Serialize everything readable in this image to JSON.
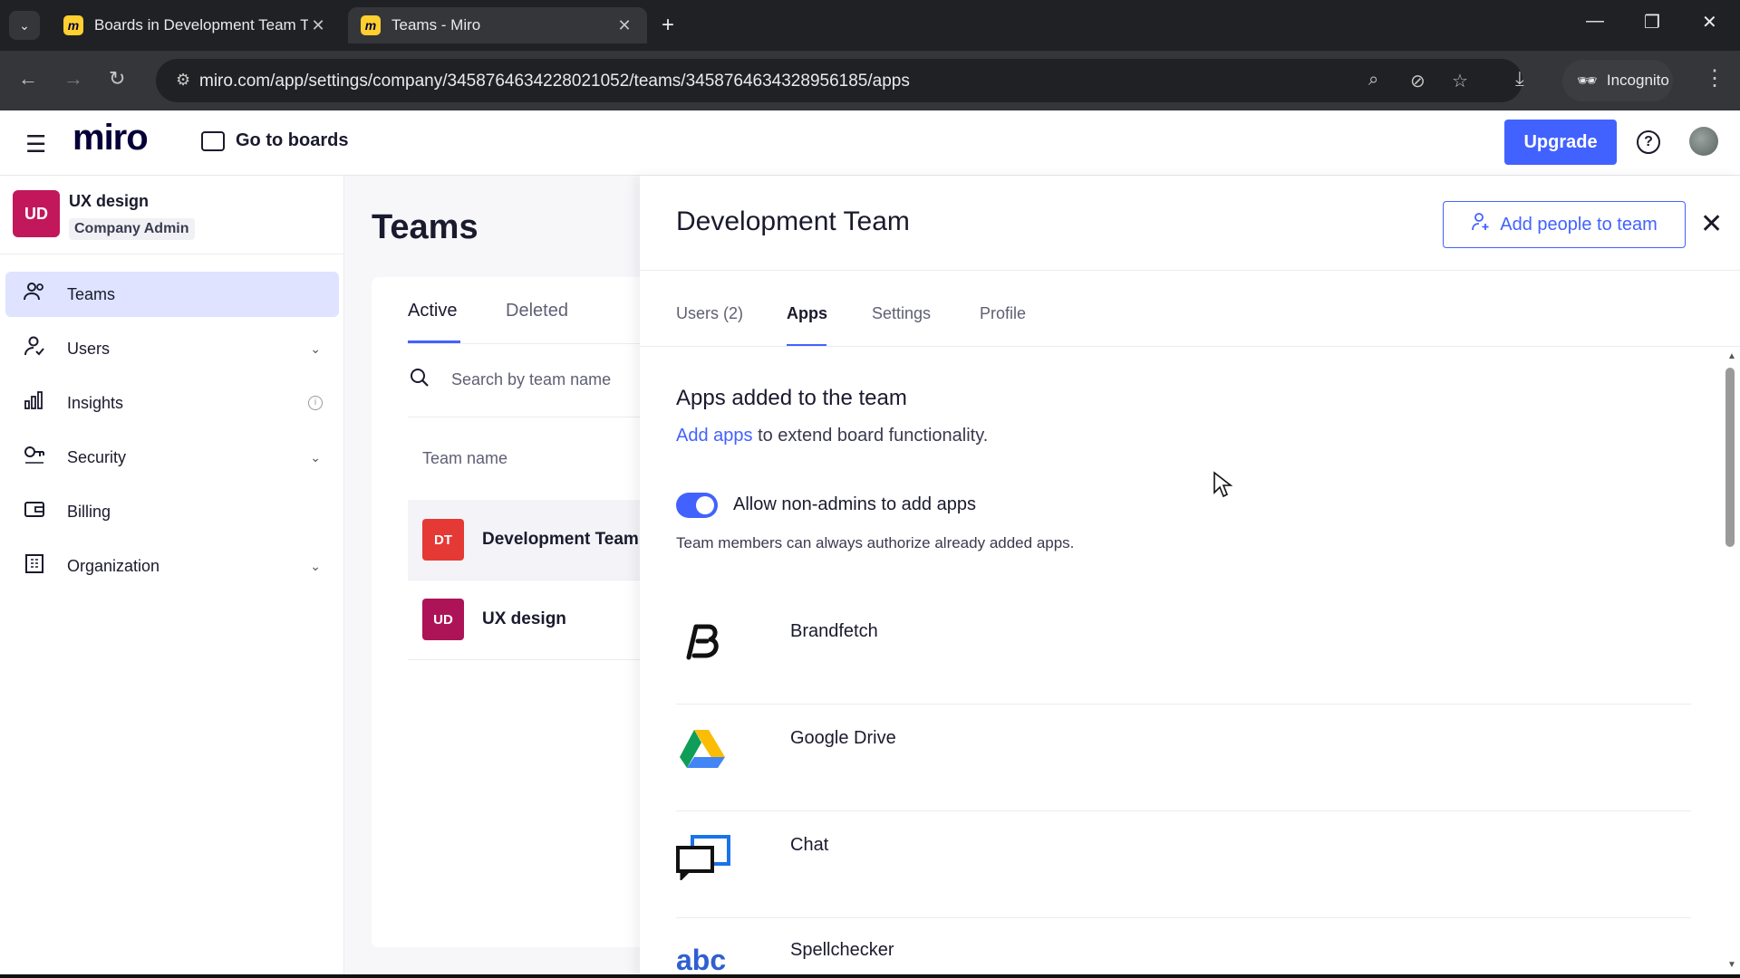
{
  "browser": {
    "tabs": [
      {
        "favicon": "miro-icon",
        "title": "Boards in Development Team Te",
        "active": false
      },
      {
        "favicon": "miro-icon",
        "title": "Teams - Miro",
        "active": true
      }
    ],
    "favicon_letter": "m",
    "url": "miro.com/app/settings/company/3458764634228021052/teams/3458764634328956185/apps",
    "incognito_label": "Incognito"
  },
  "header": {
    "logo": "miro",
    "go_to_boards": "Go to boards",
    "upgrade": "Upgrade",
    "help": "?",
    "accent": "#4262ff"
  },
  "sidebar": {
    "org": {
      "initials": "UD",
      "name": "UX design",
      "role": "Company Admin",
      "color": "#c2185b"
    },
    "items": [
      {
        "label": "Teams",
        "icon": "people-icon",
        "active": true
      },
      {
        "label": "Users",
        "icon": "user-icon",
        "expandable": true
      },
      {
        "label": "Insights",
        "icon": "bar-chart-icon",
        "info": true
      },
      {
        "label": "Security",
        "icon": "key-icon",
        "expandable": true
      },
      {
        "label": "Billing",
        "icon": "wallet-icon"
      },
      {
        "label": "Organization",
        "icon": "building-icon",
        "expandable": true
      }
    ]
  },
  "teams_panel": {
    "title": "Teams",
    "tabs": [
      "Active",
      "Deleted"
    ],
    "search_placeholder": "Search by team name",
    "column_header": "Team name",
    "rows": [
      {
        "initials": "DT",
        "name": "Development Team",
        "color": "#e53935",
        "selected": true
      },
      {
        "initials": "UD",
        "name": "UX design",
        "color": "#ad1457",
        "selected": false
      }
    ]
  },
  "detail": {
    "title": "Development Team",
    "add_people": "Add people to team",
    "tabs": [
      "Users (2)",
      "Apps",
      "Settings",
      "Profile"
    ],
    "active_tab": "Apps",
    "section_title": "Apps added to the team",
    "add_apps_link": "Add apps",
    "add_apps_rest": " to extend board functionality.",
    "toggle_label": "Allow non-admins to add apps",
    "toggle_on": true,
    "toggle_help": "Team members can always authorize already added apps.",
    "apps": [
      {
        "name": "Brandfetch",
        "icon": "brandfetch-icon"
      },
      {
        "name": "Google Drive",
        "icon": "google-drive-icon"
      },
      {
        "name": "Chat",
        "icon": "chat-icon"
      },
      {
        "name": "Spellchecker",
        "icon": "spellchecker-icon",
        "icon_text": "abc"
      }
    ]
  }
}
